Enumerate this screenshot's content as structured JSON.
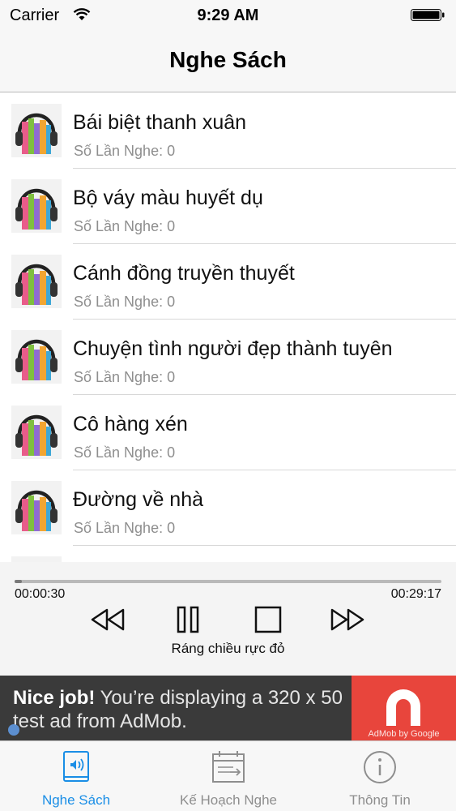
{
  "status_bar": {
    "carrier": "Carrier",
    "time": "9:29 AM"
  },
  "nav": {
    "title": "Nghe Sách"
  },
  "books": [
    {
      "title": "Bái biệt thanh xuân",
      "plays": "Số Lần Nghe: 0"
    },
    {
      "title": "Bộ váy màu huyết dụ",
      "plays": "Số Lần Nghe: 0"
    },
    {
      "title": "Cánh đồng truyền thuyết",
      "plays": "Số Lần Nghe: 0"
    },
    {
      "title": "Chuyện tình người đẹp thành tuyên",
      "plays": "Số Lần Nghe: 0"
    },
    {
      "title": "Cô hàng xén",
      "plays": "Số Lần Nghe: 0"
    },
    {
      "title": "Đường về nhà",
      "plays": "Số Lần Nghe: 0"
    }
  ],
  "player": {
    "elapsed": "00:00:30",
    "total": "00:29:17",
    "progress_fraction": 0.017,
    "now_playing": "Ráng chiều rực đỏ",
    "controls": [
      "rewind-icon",
      "pause-icon",
      "stop-icon",
      "fast-forward-icon"
    ]
  },
  "ad": {
    "bold": "Nice job!",
    "text": " You’re displaying a 320 x 50 test ad from AdMob.",
    "brand": "AdMob by Google",
    "brand_color": "#e8453c"
  },
  "tabs": [
    {
      "label": "Nghe Sách",
      "icon": "audiobook-icon",
      "active": true
    },
    {
      "label": "Kế Hoạch Nghe",
      "icon": "calendar-icon",
      "active": false
    },
    {
      "label": "Thông Tin",
      "icon": "info-icon",
      "active": false
    }
  ],
  "colors": {
    "accent": "#1a8ee6",
    "ad_background": "#3a3a3a"
  }
}
